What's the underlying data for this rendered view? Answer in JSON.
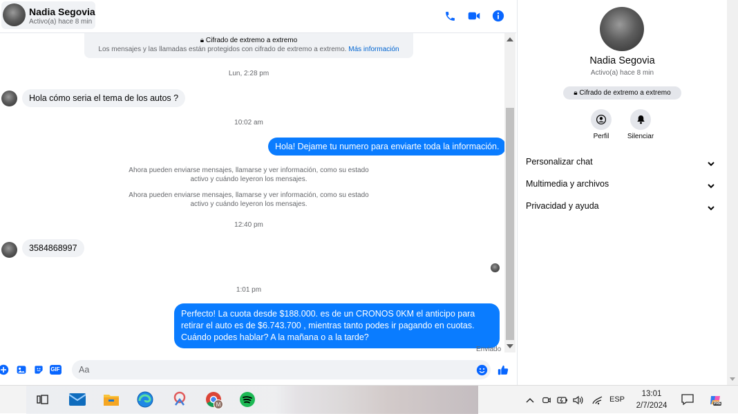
{
  "header": {
    "contact_name": "Nadia Segovia",
    "contact_status": "Activo(a) hace 8 min",
    "call_icon": "phone-icon",
    "video_icon": "video-camera-icon",
    "info_icon": "info-icon"
  },
  "encryption_notice": {
    "title": "Cifrado de extremo a extremo",
    "text": "Los mensajes y las llamadas están protegidos con cifrado de extremo a extremo.",
    "link": "Más información"
  },
  "messages": {
    "ts1": "Lun, 2:28 pm",
    "m1": "Hola cómo seria el tema de los autos ?",
    "ts2": "10:02 am",
    "m2": "Hola! Dejame tu numero  para enviarte toda la información.",
    "sys1": "Ahora pueden enviarse mensajes, llamarse y ver información, como su estado activo y cuándo leyeron los mensajes.",
    "sys2": "Ahora pueden enviarse mensajes, llamarse y ver información, como su estado activo y cuándo leyeron los mensajes.",
    "ts3": "12:40 pm",
    "m3": "3584868997",
    "ts4": "1:01 pm",
    "m4": "Perfecto! La cuota desde $188.000. es de un CRONOS 0KM el anticipo para retirar el auto es de $6.743.700 , mientras tanto podes ir pagando en cuotas. Cuándo podes hablar? A la mañana o a la tarde?",
    "sent_label": "Enviado"
  },
  "composer": {
    "placeholder": "Aa",
    "icons": [
      "plus-circle-icon",
      "image-icon",
      "sticker-icon",
      "gif-icon",
      "emoji-icon",
      "thumbs-up-icon"
    ],
    "gif_label": "GIF"
  },
  "info_panel": {
    "name": "Nadia Segovia",
    "status": "Activo(a) hace 8 min",
    "e2e_label": "Cifrado de extremo a extremo",
    "profile_label": "Perfil",
    "mute_label": "Silenciar",
    "sections": [
      "Personalizar chat",
      "Multimedia y archivos",
      "Privacidad y ayuda"
    ]
  },
  "taskbar": {
    "apps": [
      "task-view-icon",
      "mail-icon",
      "file-explorer-icon",
      "edge-icon",
      "snipping-tool-icon",
      "chrome-icon",
      "spotify-icon"
    ],
    "chrome_badge": "M",
    "language": "ESP",
    "time": "13:01",
    "date": "2/7/2024",
    "copilot_badge": "PRE"
  },
  "colors": {
    "accent": "#0a7cff",
    "icon_blue": "#0866ff",
    "incoming_bubble": "#f0f2f5",
    "spotify": "#1db954"
  }
}
